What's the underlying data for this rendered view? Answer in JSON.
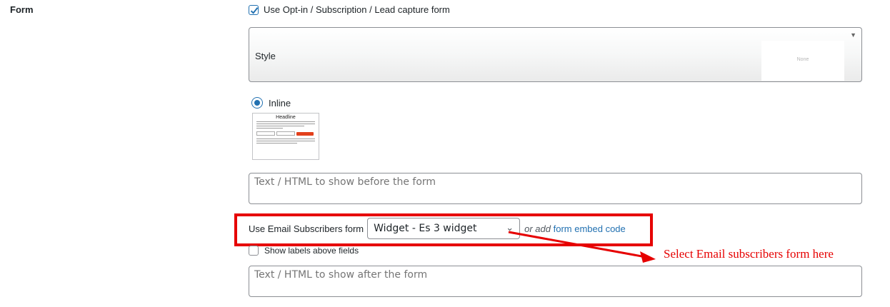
{
  "section": {
    "label": "Form"
  },
  "enable_form": {
    "label": "Use Opt-in / Subscription / Lead capture form",
    "checked": true
  },
  "style_select": {
    "label": "Style",
    "preview_value": "None"
  },
  "layout": {
    "option_label": "Inline",
    "preview": {
      "headline": "Headline"
    }
  },
  "before_form": {
    "placeholder": "Text / HTML to show before the form"
  },
  "email_form": {
    "label": "Use Email Subscribers form",
    "selected": "Widget - Es 3 widget",
    "or_text": "or add",
    "embed_link": "form embed code"
  },
  "show_labels": {
    "label": "Show labels above fields",
    "checked": false
  },
  "after_form": {
    "placeholder": "Text / HTML to show after the form"
  },
  "annotation": {
    "text": "Select Email subscribers form here",
    "color": "#e60000"
  },
  "colors": {
    "accent": "#2271b1",
    "highlight": "#e60000"
  }
}
